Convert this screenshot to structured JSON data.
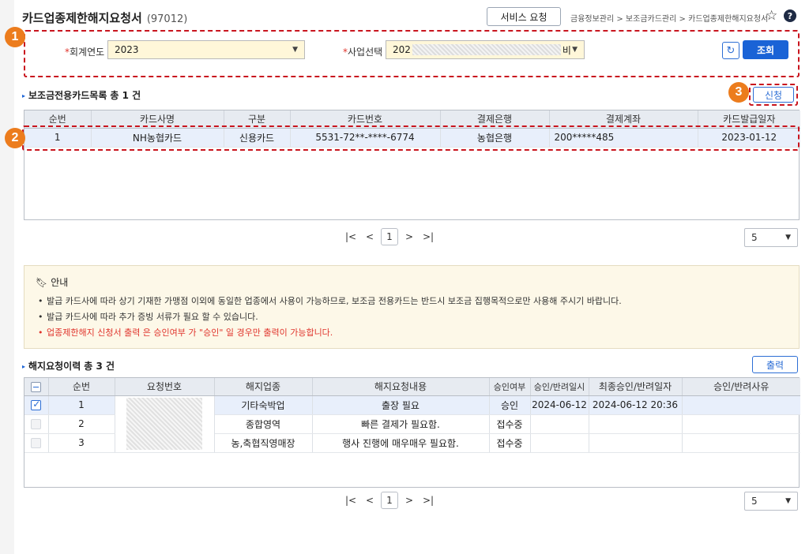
{
  "header": {
    "title": "카드업종제한해지요청서",
    "code": "(97012)",
    "service_button": "서비스 요청",
    "breadcrumb": "금융정보관리 > 보조금카드관리 > 카드업종제한해지요청서",
    "star_icon": "star-icon",
    "help_icon": "help-icon"
  },
  "search": {
    "fiscal_year_label": "회계연도",
    "fiscal_year_value": "2023",
    "project_label": "사업선택",
    "project_value_prefix": "202",
    "project_value_suffix": "비",
    "query_button": "조회",
    "refresh_icon": "refresh-icon"
  },
  "badges": [
    "1",
    "2",
    "3"
  ],
  "card_list": {
    "title": "보조금전용카드목록",
    "count_text": "총 1 건",
    "apply_button": "신청",
    "columns": [
      "순번",
      "카드사명",
      "구분",
      "카드번호",
      "결제은행",
      "결제계좌",
      "카드발급일자"
    ],
    "rows": [
      [
        "1",
        "NH농협카드",
        "신용카드",
        "5531-72**-****-6774",
        "농협은행",
        "200*****485",
        "2023-01-12"
      ]
    ]
  },
  "pager": {
    "first": "|<",
    "prev": "<",
    "page": "1",
    "next": ">",
    "last": ">|",
    "page_size": "5"
  },
  "notice": {
    "title": "안내",
    "items": [
      "발급 카드사에 따라 상기 기재한 가맹점 이외에 동일한 업종에서 사용이 가능하므로, 보조금 전용카드는 반드시 보조금 집행목적으로만 사용해 주시기 바랍니다.",
      "발급 카드사에 따라 추가 증빙 서류가 필요 할 수 있습니다."
    ],
    "warning": "업종제한해지 신청서 출력 은 승인여부 가 \"승인\" 일 경우만 출력이 가능합니다."
  },
  "history": {
    "title": "해지요청이력",
    "count_text": "총 3 건",
    "print_button": "출력",
    "columns": [
      "",
      "순번",
      "요청번호",
      "해지업종",
      "해지요청내용",
      "승인여부",
      "승인/반려일시",
      "최종승인/반려일자",
      "승인/반려사유"
    ],
    "rows": [
      {
        "checked": true,
        "no": "1",
        "category": "기타숙박업",
        "content": "출장 필요",
        "status": "승인",
        "datetime": "2024-06-12",
        "final_date": "2024-06-12 20:36",
        "reason": ""
      },
      {
        "checked": false,
        "no": "2",
        "category": "종합영역",
        "content": "빠른 결제가 필요함.",
        "status": "접수중",
        "datetime": "",
        "final_date": "",
        "reason": ""
      },
      {
        "checked": false,
        "no": "3",
        "category": "농,축협직영매장",
        "content": "행사 진행에 매우매우 필요함.",
        "status": "접수중",
        "datetime": "",
        "final_date": "",
        "reason": ""
      }
    ]
  },
  "colors": {
    "primary": "#1a63d6",
    "badge": "#ec7c1d",
    "highlight_dash": "#c9151e",
    "notice_bg": "#fdf8e8",
    "warning_text": "#e0342c"
  }
}
